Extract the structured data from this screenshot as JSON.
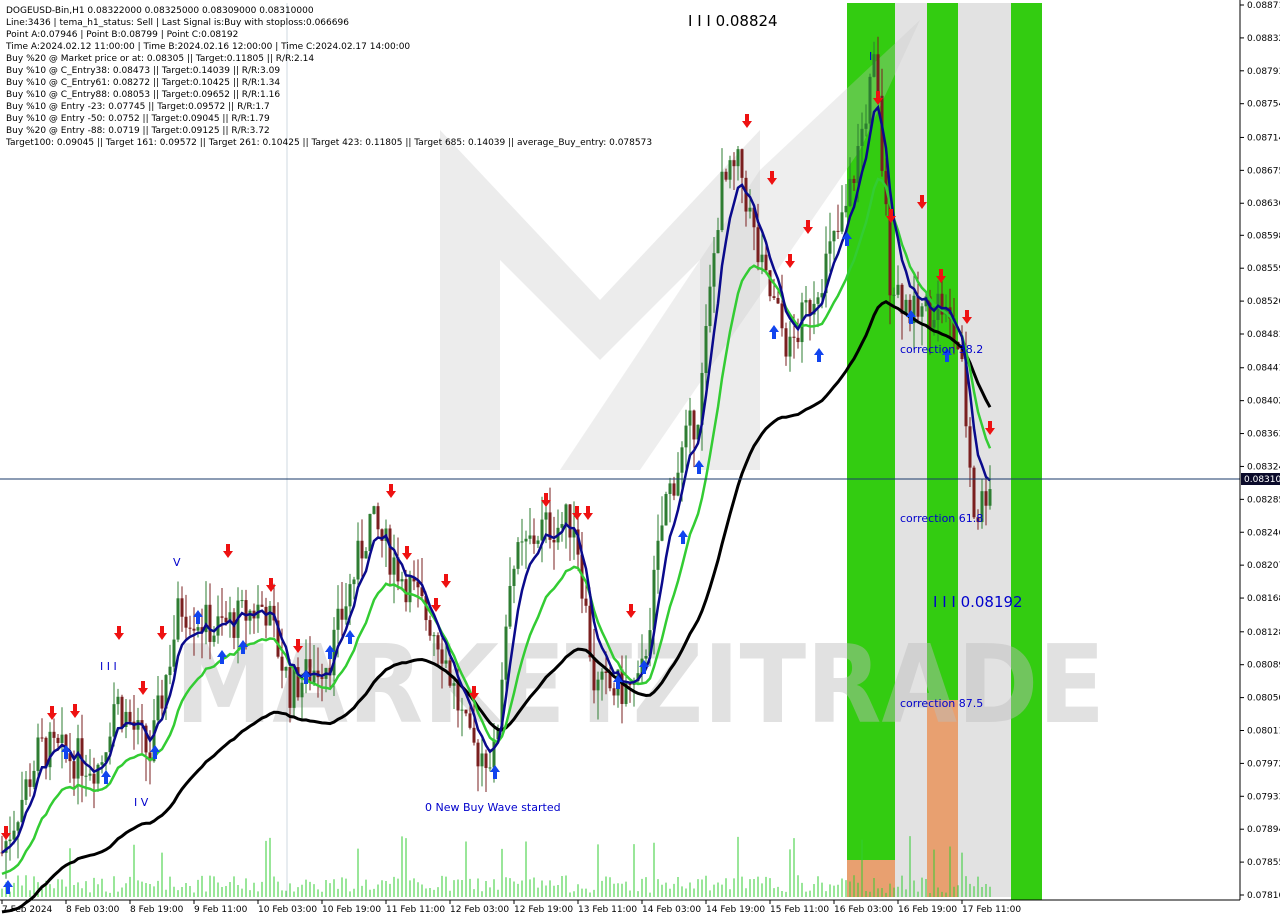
{
  "chart_data": {
    "type": "candlestick",
    "symbol_line": "DOGEUSD-Bin,H1  0.08322000 0.08325000 0.08309000 0.08310000",
    "info_lines": [
      "Line:3436 | tema_h1_status: Sell | Last Signal is:Buy with stoploss:0.066696",
      "Point A:0.07946 | Point B:0.08799 | Point C:0.08192",
      "Time A:2024.02.12 11:00:00 | Time B:2024.02.16 12:00:00 | Time C:2024.02.17 14:00:00",
      "Buy %20 @ Market price or at: 0.08305 || Target:0.11805 || R/R:2.14",
      "Buy %10 @ C_Entry38: 0.08473 || Target:0.14039 || R/R:3.09",
      "Buy %10 @ C_Entry61: 0.08272 || Target:0.10425 || R/R:1.34",
      "Buy %10 @ C_Entry88: 0.08053 || Target:0.09652 || R/R:1.16",
      "Buy %10 @ Entry -23: 0.07745 || Target:0.09572 || R/R:1.7",
      "Buy %10 @ Entry -50: 0.0752 || Target:0.09045 || R/R:1.79",
      "Buy %20 @ Entry -88: 0.0719 || Target:0.09125 || R/R:3.72",
      "Target100: 0.09045 || Target 161: 0.09572 || Target 261: 0.10425 || Target 423: 0.11805 || Target 685: 0.14039 || average_Buy_entry: 0.078573"
    ],
    "y_ticks": [
      "0.08871",
      "0.08832",
      "0.08793",
      "0.08754",
      "0.08714",
      "0.08675",
      "0.08636",
      "0.08598",
      "0.08559",
      "0.08520",
      "0.08481",
      "0.08441",
      "0.08402",
      "0.08363",
      "0.08324",
      "0.08285",
      "0.08246",
      "0.08207",
      "0.08168",
      "0.08128",
      "0.08089",
      "0.08050",
      "0.08011",
      "0.07972",
      "0.07933",
      "0.07894",
      "0.07855",
      "0.07816"
    ],
    "x_ticks": [
      "7 Feb 2024",
      "8 Feb 03:00",
      "8 Feb 19:00",
      "9 Feb 11:00",
      "10 Feb 03:00",
      "10 Feb 19:00",
      "11 Feb 11:00",
      "12 Feb 03:00",
      "12 Feb 19:00",
      "13 Feb 11:00",
      "14 Feb 03:00",
      "14 Feb 19:00",
      "15 Feb 11:00",
      "16 Feb 03:00",
      "16 Feb 19:00",
      "17 Feb 11:00"
    ],
    "y_range": [
      0.07816,
      0.08871
    ],
    "current_price": "0.08310",
    "current_price_value": 0.0831,
    "annotations": {
      "top_level": "I I I 0.08824",
      "c_level": "I I I 0.08192",
      "new_wave": "0 New Buy Wave started",
      "corr38": "correction 38.2",
      "corr61": "correction 61.8",
      "corr87": "correction 87.5",
      "wave_v": "V",
      "wave_iii": "I I I",
      "wave_iv": "I V",
      "wave_i": "I"
    },
    "watermark": "MARKETZITRADE",
    "colors": {
      "bull_candle": "#2e7d32",
      "bear_candle": "#7a1f1f",
      "tema_line": "#0a0a8c",
      "ma_green": "#33cc33",
      "ma_black": "#000000",
      "zone_green": "#33cc11",
      "zone_orange": "#e8a070",
      "buy_arrow": "#1144ee",
      "sell_arrow": "#ee1111",
      "price_line": "#1a3a6a"
    },
    "grid": false
  }
}
